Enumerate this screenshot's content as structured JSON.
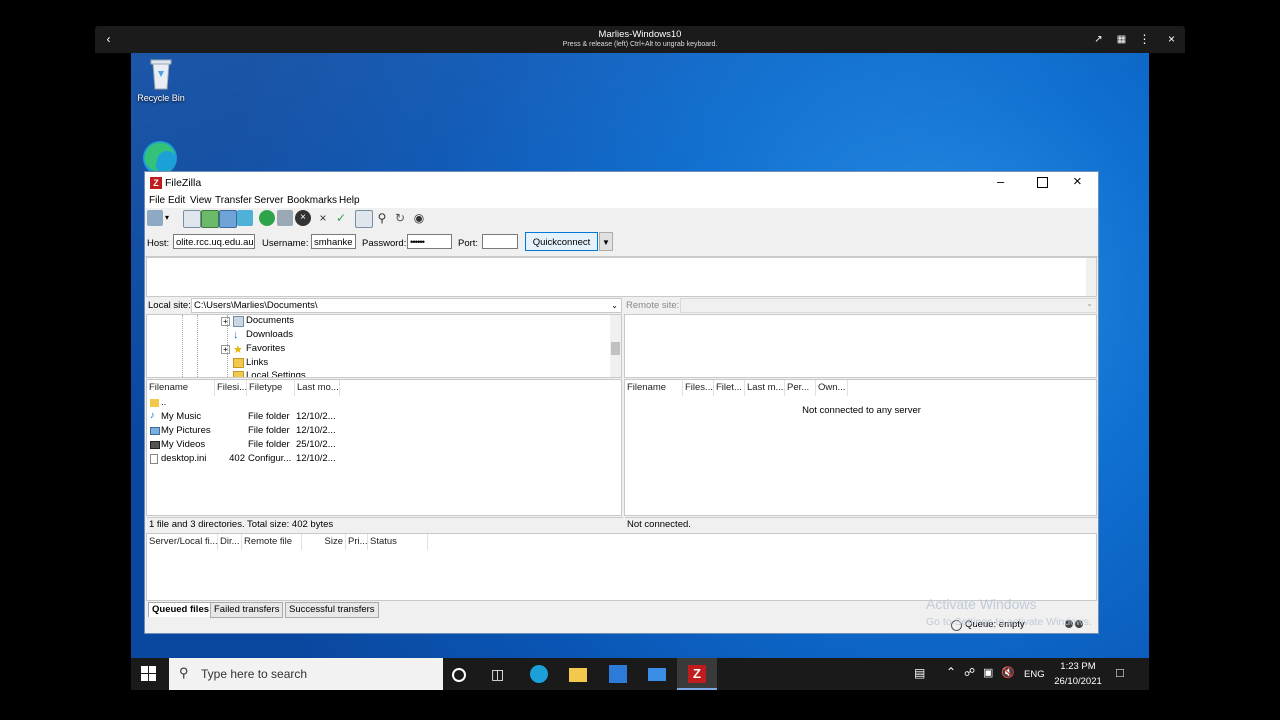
{
  "viewer": {
    "title": "Marlies-Windows10",
    "subtitle": "Press & release (left) Ctrl+Alt to ungrab keyboard."
  },
  "desktop": {
    "recycle_bin_label": "Recycle Bin"
  },
  "window": {
    "title": "FileZilla",
    "menu": [
      "File",
      "Edit",
      "View",
      "Transfer",
      "Server",
      "Bookmarks",
      "Help"
    ]
  },
  "quickconnect": {
    "host_label": "Host:",
    "host_value": "olite.rcc.uq.edu.au",
    "username_label": "Username:",
    "username_value": "smhanke",
    "password_label": "Password:",
    "password_value": "••••••",
    "port_label": "Port:",
    "port_value": "",
    "button_label": "Quickconnect"
  },
  "local": {
    "site_label": "Local site:",
    "site_path": "C:\\Users\\Marlies\\Documents\\",
    "tree": [
      "Documents",
      "Downloads",
      "Favorites",
      "Links",
      "Local Settings"
    ],
    "columns": [
      "Filename",
      "Filesi...",
      "Filetype",
      "Last mo..."
    ],
    "files": [
      {
        "name": "..",
        "size": "",
        "type": "",
        "modified": ""
      },
      {
        "name": "My Music",
        "size": "",
        "type": "File folder",
        "modified": "12/10/2..."
      },
      {
        "name": "My Pictures",
        "size": "",
        "type": "File folder",
        "modified": "12/10/2..."
      },
      {
        "name": "My Videos",
        "size": "",
        "type": "File folder",
        "modified": "25/10/2..."
      },
      {
        "name": "desktop.ini",
        "size": "402",
        "type": "Configur...",
        "modified": "12/10/2..."
      }
    ],
    "status": "1 file and 3 directories. Total size: 402 bytes"
  },
  "remote": {
    "site_label": "Remote site:",
    "columns": [
      "Filename",
      "Files...",
      "Filet...",
      "Last m...",
      "Per...",
      "Own..."
    ],
    "empty_message": "Not connected to any server",
    "status": "Not connected."
  },
  "queue": {
    "columns": [
      "Server/Local fi...",
      "Dir...",
      "Remote file",
      "Size",
      "Pri...",
      "Status"
    ],
    "tabs": [
      "Queued files",
      "Failed transfers",
      "Successful transfers"
    ],
    "status": "Queue: empty"
  },
  "watermark": {
    "line1": "Activate Windows",
    "line2": "Go to Settings to activate Windows."
  },
  "taskbar": {
    "search_placeholder": "Type here to search",
    "lang": "ENG",
    "time": "1:23 PM",
    "date": "26/10/2021"
  },
  "colors": {
    "desktop_blue": "#0f6fd0",
    "taskbar": "#1a1a1a",
    "filezilla_red": "#bf1d1d"
  }
}
